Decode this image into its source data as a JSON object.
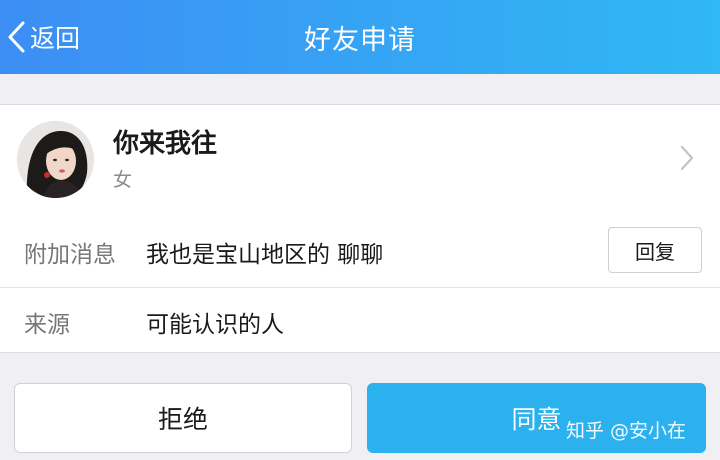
{
  "nav": {
    "back_label": "返回",
    "title": "好友申请"
  },
  "profile": {
    "name": "你来我往",
    "gender": "女"
  },
  "details": [
    {
      "label": "附加消息",
      "value": "我也是宝山地区的 聊聊",
      "action": "回复"
    },
    {
      "label": "来源",
      "value": "可能认识的人"
    }
  ],
  "actions": {
    "reject": "拒绝",
    "accept": "同意"
  },
  "watermark": "知乎 @安小在",
  "colors": {
    "nav_start": "#3d8ef4",
    "nav_end": "#2fb8f4",
    "accept": "#2ab1ee",
    "background": "#f0f0f4"
  }
}
